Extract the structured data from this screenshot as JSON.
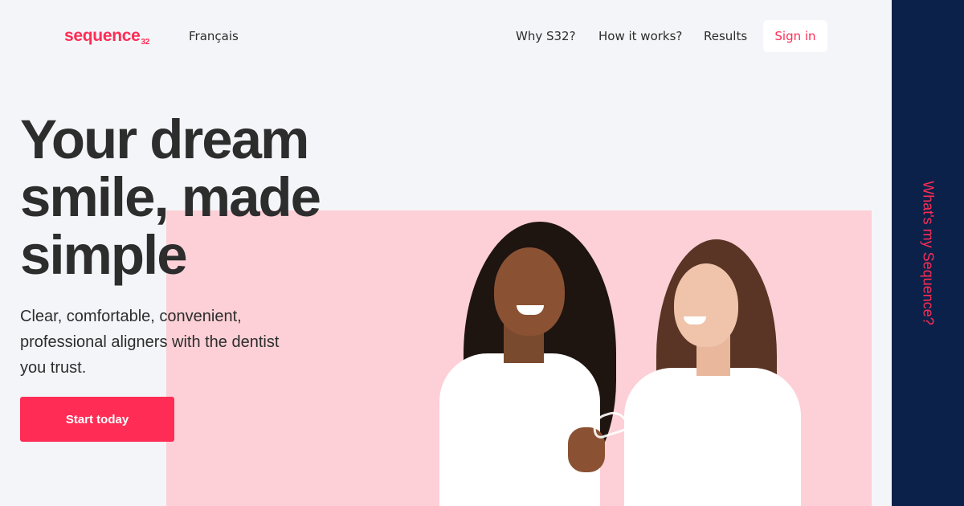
{
  "header": {
    "logo_text": "sequence",
    "logo_sub": "32",
    "language_link": "Français",
    "nav": [
      {
        "label": "Why S32?"
      },
      {
        "label": "How it works?"
      },
      {
        "label": "Results"
      }
    ],
    "signin_label": "Sign in"
  },
  "hero": {
    "headline": "Your dream smile, made simple",
    "subhead": "Clear, comfortable, convenient, professional aligners with the dentist you trust.",
    "cta_label": "Start today"
  },
  "side_panel": {
    "label": "What's my Sequence?"
  },
  "colors": {
    "brand": "#ff2d55",
    "background": "#f4f5f9",
    "panel": "#0c2149",
    "photo_bg": "#fcd0d6"
  }
}
